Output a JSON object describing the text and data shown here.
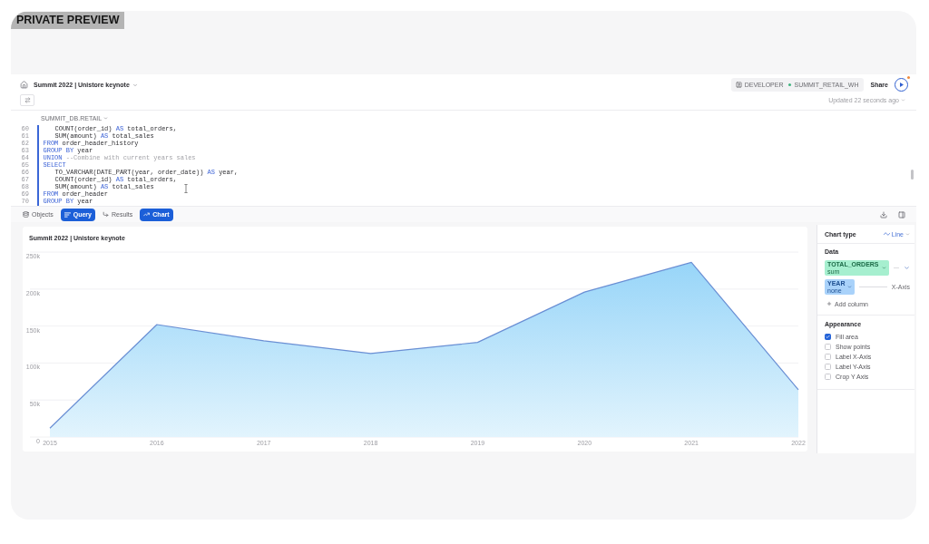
{
  "preview_label": "PRIVATE PREVIEW",
  "header": {
    "title": "Summit 2022 | Unistore keynote",
    "role": "DEVELOPER",
    "warehouse": "SUMMIT_RETAIL_WH",
    "share": "Share",
    "updated": "Updated 22 seconds ago"
  },
  "editor": {
    "database": "SUMMIT_DB.RETAIL",
    "lines": [
      {
        "number": "60",
        "indented": true,
        "tokens": [
          {
            "kind": "plain",
            "text": "COUNT(order_id) "
          },
          {
            "kind": "keyword",
            "text": "AS"
          },
          {
            "kind": "plain",
            "text": " total_orders,"
          }
        ]
      },
      {
        "number": "61",
        "indented": true,
        "tokens": [
          {
            "kind": "plain",
            "text": "SUM(amount) "
          },
          {
            "kind": "keyword",
            "text": "AS"
          },
          {
            "kind": "plain",
            "text": " total_sales"
          }
        ]
      },
      {
        "number": "62",
        "indented": false,
        "tokens": [
          {
            "kind": "keyword",
            "text": "FROM"
          },
          {
            "kind": "plain",
            "text": " order_header_history"
          }
        ]
      },
      {
        "number": "63",
        "indented": false,
        "tokens": [
          {
            "kind": "keyword",
            "text": "GROUP BY"
          },
          {
            "kind": "plain",
            "text": " year"
          }
        ]
      },
      {
        "number": "64",
        "indented": false,
        "tokens": [
          {
            "kind": "keyword",
            "text": "UNION"
          },
          {
            "kind": "comment",
            "text": " --Combine with current years sales"
          }
        ]
      },
      {
        "number": "65",
        "indented": false,
        "tokens": [
          {
            "kind": "keyword",
            "text": "SELECT"
          }
        ]
      },
      {
        "number": "66",
        "indented": true,
        "tokens": [
          {
            "kind": "plain",
            "text": "TO_VARCHAR(DATE_PART(year, order_date)) "
          },
          {
            "kind": "keyword",
            "text": "AS"
          },
          {
            "kind": "plain",
            "text": " year,"
          }
        ]
      },
      {
        "number": "67",
        "indented": true,
        "tokens": [
          {
            "kind": "plain",
            "text": "COUNT(order_id) "
          },
          {
            "kind": "keyword",
            "text": "AS"
          },
          {
            "kind": "plain",
            "text": " total_orders,"
          }
        ]
      },
      {
        "number": "68",
        "indented": true,
        "tokens": [
          {
            "kind": "plain",
            "text": "SUM(amount) "
          },
          {
            "kind": "keyword",
            "text": "AS"
          },
          {
            "kind": "plain",
            "text": " total_sales"
          }
        ]
      },
      {
        "number": "69",
        "indented": false,
        "tokens": [
          {
            "kind": "keyword",
            "text": "FROM"
          },
          {
            "kind": "plain",
            "text": " order_header"
          }
        ]
      },
      {
        "number": "70",
        "indented": false,
        "tokens": [
          {
            "kind": "keyword",
            "text": "GROUP BY"
          },
          {
            "kind": "plain",
            "text": " year"
          }
        ]
      }
    ]
  },
  "tabs": [
    {
      "label": "Objects",
      "selected": false
    },
    {
      "label": "Query",
      "selected": true
    },
    {
      "label": "Results",
      "selected": false
    },
    {
      "label": "Chart",
      "selected": true
    }
  ],
  "chart": {
    "title": "Summit 2022 | Unistore keynote",
    "chart_data": {
      "type": "area",
      "categories": [
        "2015",
        "2016",
        "2017",
        "2018",
        "2019",
        "2020",
        "2021",
        "2022"
      ],
      "series": [
        {
          "color": "#6a8fd4",
          "values": [
            12000,
            152000,
            130000,
            113000,
            128000,
            196000,
            236000,
            64000
          ]
        }
      ],
      "ylim": [
        0,
        250000
      ],
      "yticks": [
        {
          "value": 0,
          "label": "0"
        },
        {
          "value": 50000,
          "label": "50k"
        },
        {
          "value": 100000,
          "label": "100k"
        },
        {
          "value": 150000,
          "label": "150k"
        },
        {
          "value": 200000,
          "label": "200k"
        },
        {
          "value": 250000,
          "label": "250k"
        }
      ],
      "grid": true
    }
  },
  "chart_settings": {
    "chart_type_heading": "Chart type",
    "chart_type": "Line",
    "data_heading": "Data",
    "columns": [
      {
        "kind": "measure",
        "name": "TOTAL_ORDERS",
        "aggregation": "sum",
        "color": "#a6efcf"
      },
      {
        "kind": "dimension",
        "name": "YEAR",
        "aggregation": "none",
        "color": "#a9d2fa",
        "axis": "X-Axis"
      }
    ],
    "add_column": "Add column",
    "appearance_heading": "Appearance",
    "options": [
      {
        "label": "Fill area",
        "checked": true
      },
      {
        "label": "Show points",
        "checked": false
      },
      {
        "label": "Label X-Axis",
        "checked": false
      },
      {
        "label": "Label Y-Axis",
        "checked": false
      },
      {
        "label": "Crop Y Axis",
        "checked": false
      }
    ]
  }
}
